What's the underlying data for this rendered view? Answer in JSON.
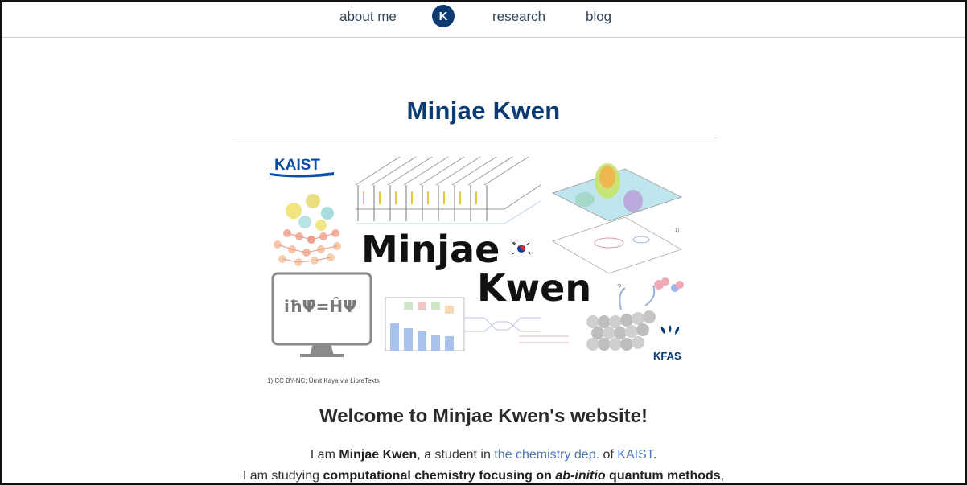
{
  "nav": {
    "about_label": "about me",
    "logo_letter": "K",
    "research_label": "research",
    "blog_label": "blog"
  },
  "page_title": "Minjae Kwen",
  "hero": {
    "kaist_logo": "KAIST",
    "name_line1": "Minjae",
    "name_line2": "Kwen",
    "equation": "iħΨ̇=ĤΨ",
    "kfas_logo": "KFAS",
    "question_mark": "?",
    "footnote_marker": "1)",
    "credit": "1) CC BY-NC; Ümit Kaya via LibreTexts"
  },
  "welcome_heading": "Welcome to Minjae Kwen's website!",
  "intro": {
    "line1_prefix": "I am ",
    "line1_name": "Minjae Kwen",
    "line1_mid": ", a student in ",
    "line1_link1": "the chemistry dep.",
    "line1_of": " of ",
    "line1_link2": "KAIST",
    "line1_end": ".",
    "line2_prefix": "I am studying ",
    "line2_bold": "computational chemistry focusing on ",
    "line2_italic": "ab-initio",
    "line2_bold2": " quantum methods",
    "line2_end": ","
  },
  "colors": {
    "brand_navy": "#0c3b73",
    "link_blue": "#4a76b6"
  }
}
